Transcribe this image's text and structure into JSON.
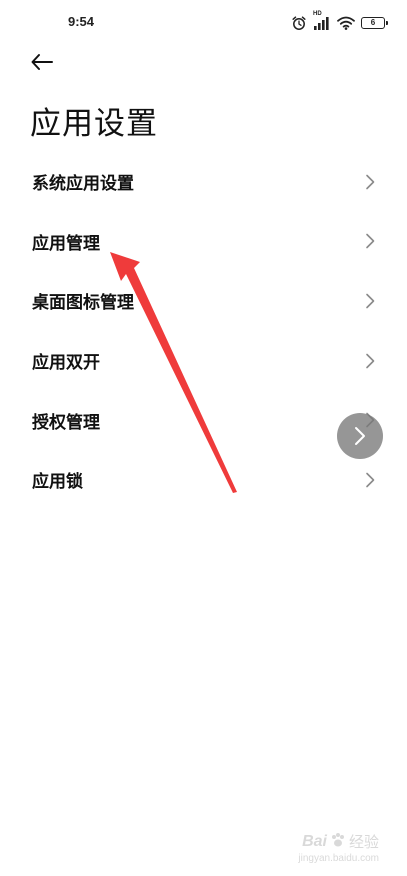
{
  "status_bar": {
    "time": "9:54",
    "hd_label": "HD",
    "battery_level": "6",
    "icons": [
      "alarm-icon",
      "signal-icon",
      "wifi-icon",
      "battery-icon"
    ]
  },
  "header": {
    "back_icon": "back-arrow-icon",
    "title": "应用设置"
  },
  "menu": {
    "items": [
      {
        "label": "系统应用设置"
      },
      {
        "label": "应用管理"
      },
      {
        "label": "桌面图标管理"
      },
      {
        "label": "应用双开"
      },
      {
        "label": "授权管理"
      },
      {
        "label": "应用锁"
      }
    ]
  },
  "floating_button": {
    "icon": "chevron-right-icon"
  },
  "annotation": {
    "color": "#ef3b3b"
  },
  "watermark": {
    "brand": "Bai",
    "jingyan": "经验",
    "url": "jingyan.baidu.com"
  },
  "colors": {
    "background": "#ffffff",
    "text": "#111111",
    "chevron": "#8a8a8a",
    "float_button": "#7a7a7a"
  }
}
